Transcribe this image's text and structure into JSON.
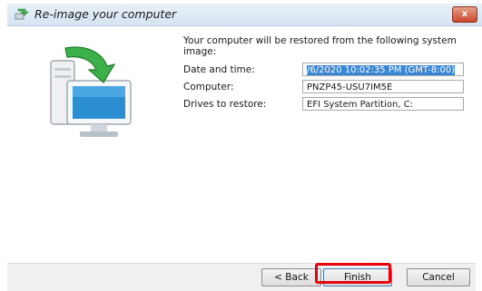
{
  "window": {
    "title": "Re-image your computer",
    "close_label": "x"
  },
  "main": {
    "intro": "Your computer will be restored from the following system image:",
    "fields": [
      {
        "label": "Date and time:",
        "value_selected": "/6/2020 10:02:35 PM (GMT-8:00)"
      },
      {
        "label": "Computer:",
        "value": "PNZP45-USU7IM5E"
      },
      {
        "label": "Drives to restore:",
        "value": "EFI System Partition, C:"
      }
    ]
  },
  "footer": {
    "back_label": "< Back",
    "finish_label": "Finish",
    "cancel_label": "Cancel"
  },
  "colors": {
    "selection": "#3a86d6",
    "highlight_ring": "#e8000b"
  },
  "icons": [
    "window-app-icon",
    "restore-computer-icon",
    "close-icon"
  ]
}
